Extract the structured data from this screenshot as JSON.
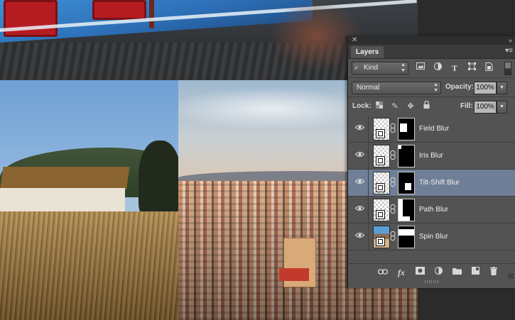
{
  "panel": {
    "tab_label": "Layers",
    "close_glyph": "✕",
    "collapse_glyph": "»",
    "menu_glyph": "▾≡"
  },
  "filter": {
    "kind_label": "Kind",
    "kind_icon": "search-icon",
    "filter_icons": [
      "image-filter-icon",
      "adjustment-filter-icon",
      "type-filter-icon",
      "shape-filter-icon",
      "smart-object-filter-icon"
    ]
  },
  "blend": {
    "mode": "Normal",
    "opacity_label": "Opacity:",
    "opacity_value": "100%"
  },
  "lock": {
    "label": "Lock:",
    "icons": [
      "lock-transparent-pixels-icon",
      "lock-image-pixels-icon",
      "lock-position-icon",
      "lock-all-icon"
    ],
    "fill_label": "Fill:",
    "fill_value": "100%"
  },
  "layers": [
    {
      "name": "Field Blur",
      "selected": false,
      "visible": true,
      "thumb": "transparent"
    },
    {
      "name": "Iris Blur",
      "selected": false,
      "visible": true,
      "thumb": "transparent"
    },
    {
      "name": "Tilt-Shift Blur",
      "selected": true,
      "visible": true,
      "thumb": "transparent"
    },
    {
      "name": "Path Blur",
      "selected": false,
      "visible": true,
      "thumb": "transparent"
    },
    {
      "name": "Spin Blur",
      "selected": false,
      "visible": true,
      "thumb": "photo"
    }
  ],
  "bottom_icons": [
    "link-layers-icon",
    "layer-style-fx-icon",
    "add-mask-icon",
    "adjustment-layer-icon",
    "new-group-folder-icon",
    "new-layer-icon",
    "delete-trash-icon"
  ],
  "colors": {
    "panel_bg": "#535353",
    "selected_row": "#6f7f97"
  }
}
